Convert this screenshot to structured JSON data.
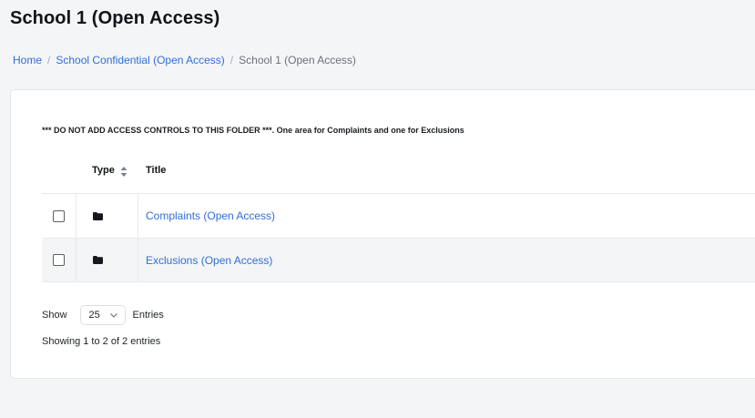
{
  "page": {
    "title": "School 1 (Open Access)"
  },
  "breadcrumb": {
    "items": [
      {
        "label": "Home"
      },
      {
        "label": "School Confidential (Open Access)"
      },
      {
        "label": "School 1 (Open Access)"
      }
    ],
    "separator": "/"
  },
  "notice": "*** DO NOT ADD ACCESS CONTROLS TO THIS FOLDER ***. One area for Complaints and one for Exclusions",
  "table": {
    "columns": [
      "Type",
      "Title"
    ],
    "sort_icon": "sort-icon",
    "rows": [
      {
        "type_icon": "folder-icon",
        "title": "Complaints (Open Access)"
      },
      {
        "type_icon": "folder-icon",
        "title": "Exclusions (Open Access)"
      }
    ]
  },
  "pagination": {
    "show_label": "Show",
    "page_size": "25",
    "entries_label": "Entries",
    "info": "Showing 1 to 2 of 2 entries"
  },
  "colors": {
    "link": "#2f6fd6",
    "background": "#f4f5f7",
    "card": "#ffffff"
  }
}
